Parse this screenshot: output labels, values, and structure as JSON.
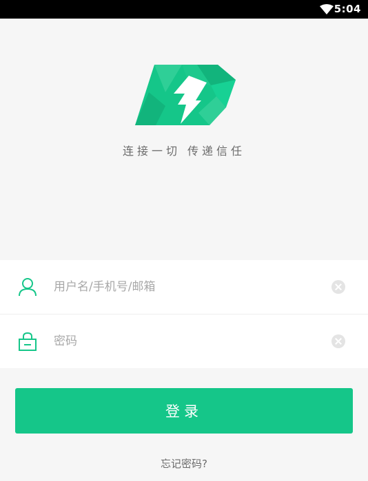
{
  "status_bar": {
    "time": "5:04",
    "wifi_icon": "wifi-icon"
  },
  "brand": {
    "logo_icon": "lightning-logo-icon",
    "slogan": "连接一切  传递信任",
    "color": "#15c689"
  },
  "login_form": {
    "username": {
      "placeholder": "用户名/手机号/邮箱",
      "value": "",
      "icon": "user-icon",
      "clear_icon": "clear-icon"
    },
    "password": {
      "placeholder": "密码",
      "value": "",
      "icon": "lock-icon",
      "clear_icon": "clear-icon"
    }
  },
  "login_button": {
    "label": "登录"
  },
  "forgot_password": {
    "label": "忘记密码?"
  }
}
